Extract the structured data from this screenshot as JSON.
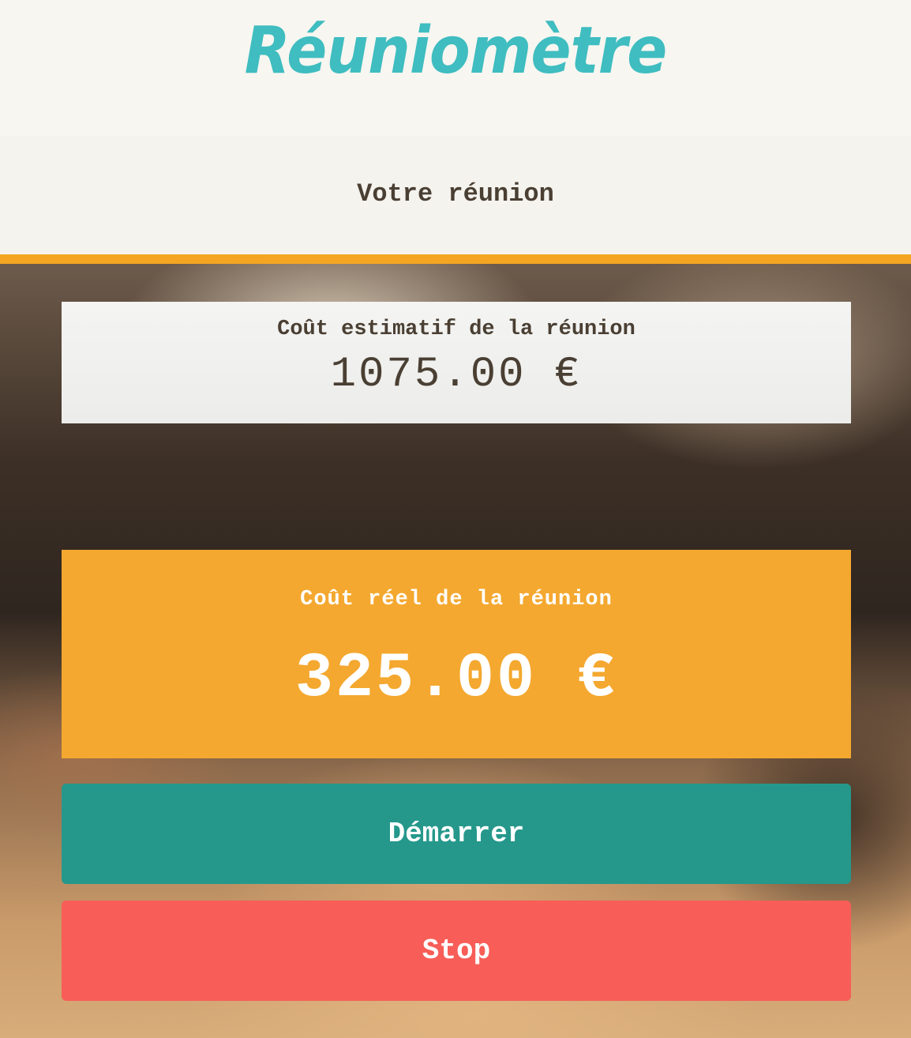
{
  "header": {
    "logo_text": "Réuniomètre"
  },
  "subheader": {
    "title": "Votre réunion"
  },
  "estimate": {
    "label": "Coût estimatif de la réunion",
    "value": "1075.00 €"
  },
  "actual": {
    "label": "Coût réel de la réunion",
    "value": "325.00 €"
  },
  "buttons": {
    "start_label": "Démarrer",
    "stop_label": "Stop"
  },
  "colors": {
    "brand": "#3fbdc0",
    "accent": "#f4a623",
    "start": "#25988b",
    "stop": "#f85d57",
    "text_dark": "#4a3f33"
  }
}
